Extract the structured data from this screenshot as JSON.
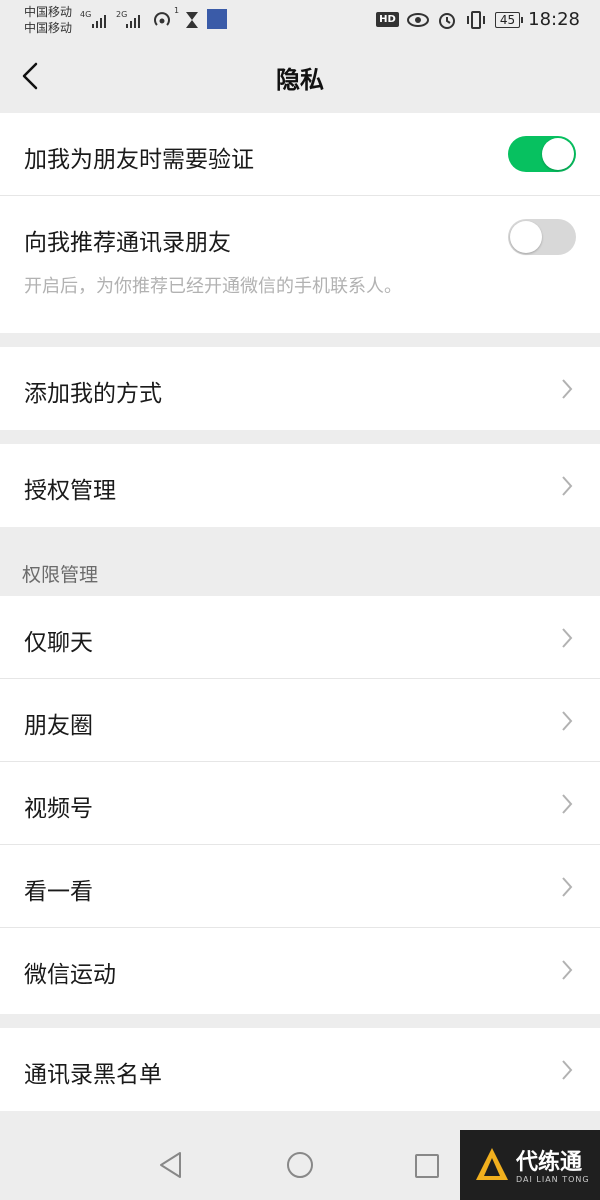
{
  "status_bar": {
    "carrier1": "中国移动",
    "carrier2": "中国移动",
    "net1": "4G",
    "net2": "2G",
    "wifi_num": "1",
    "hd": "HD",
    "battery": "45",
    "time": "18:28"
  },
  "header": {
    "title": "隐私"
  },
  "toggles": [
    {
      "label": "加我为朋友时需要验证",
      "state": "on"
    },
    {
      "label": "向我推荐通讯录朋友",
      "state": "off"
    }
  ],
  "toggle_note": "开启后，为你推荐已经开通微信的手机联系人。",
  "menu": {
    "add_method": "添加我的方式",
    "auth": "授权管理",
    "section_title": "权限管理",
    "permissions": [
      "仅聊天",
      "朋友圈",
      "视频号",
      "看一看",
      "微信运动"
    ],
    "blacklist": "通讯录黑名单"
  },
  "watermark": {
    "name": "代练通",
    "sub": "DAI LIAN TONG"
  },
  "colors": {
    "accent": "#07c160",
    "background": "#ededed"
  }
}
